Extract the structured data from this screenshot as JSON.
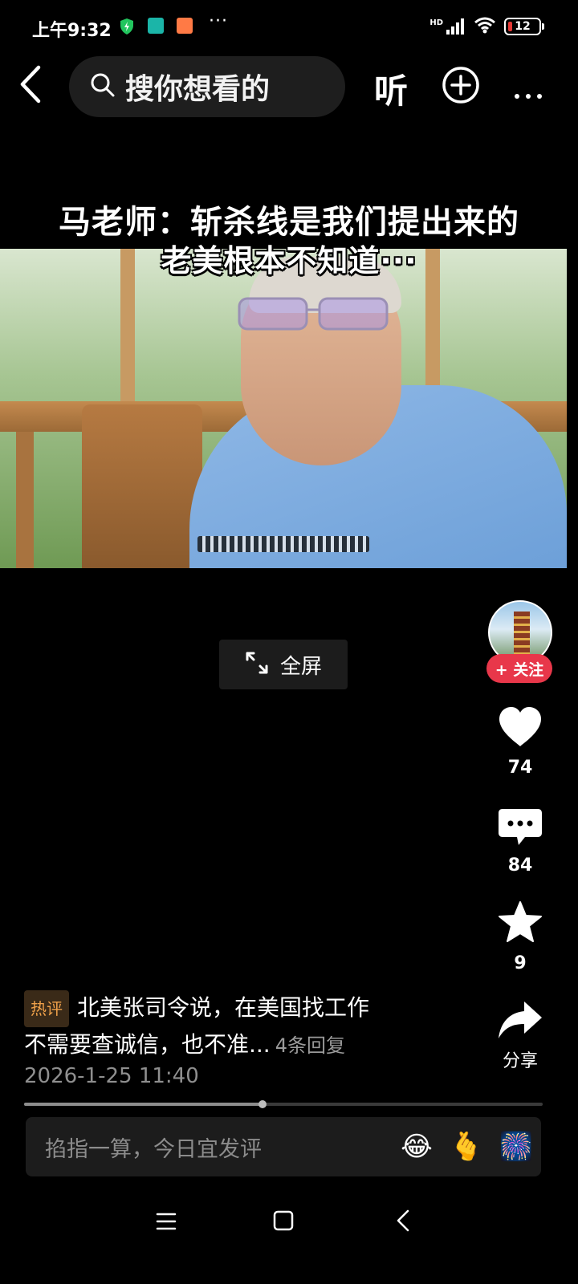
{
  "status_bar": {
    "time": "上午9:32",
    "signal_label": "HD",
    "battery": "12",
    "more": "···"
  },
  "top_bar": {
    "search_placeholder": "搜你想看的",
    "listen_label": "听"
  },
  "video": {
    "caption_line1": "马老师：斩杀线是我们提出来的",
    "caption_line2": "老美根本不知道···"
  },
  "fullscreen": {
    "label": "全屏"
  },
  "rail": {
    "follow_label": "+ 关注",
    "likes": "74",
    "comments": "84",
    "favorites": "9",
    "share_label": "分享"
  },
  "hot_comment": {
    "badge": "热评",
    "line1": "北美张司令说，在美国找工作",
    "line2": "不需要查诚信，也不准...",
    "replies": "4条回复",
    "date": "2026-1-25 11:40"
  },
  "playback": {
    "progress": 0.46
  },
  "comment_input": {
    "placeholder": "掐指一算，今日宜发评",
    "emojis": [
      "😂",
      "🫰",
      "🎆"
    ]
  },
  "colors": {
    "background": "#000000",
    "follow": "#e8374a",
    "hot_badge_text": "#f0a14a",
    "battery_low": "#e53935"
  }
}
